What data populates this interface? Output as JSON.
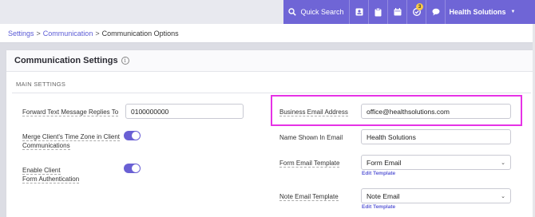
{
  "topbar": {
    "search_label": "Quick Search",
    "badge_count": "3",
    "org_name": "Health Solutions",
    "icons": [
      "search-icon",
      "contacts-icon",
      "clipboard-icon",
      "calendar-icon",
      "tasks-icon",
      "chat-icon"
    ]
  },
  "breadcrumb": {
    "items": [
      "Settings",
      "Communication",
      "Communication Options"
    ],
    "separator": ">"
  },
  "card": {
    "title": "Communication Settings",
    "info_glyph": "i",
    "section": "MAIN SETTINGS"
  },
  "left": {
    "forward_label": "Forward Text Message Replies To",
    "forward_value": "0100000000",
    "merge_label_1": "Merge Client's Time Zone in Client",
    "merge_label_2": "Communications",
    "merge_on": true,
    "enable_label_1": "Enable Client",
    "enable_label_2": "Form Authentication",
    "enable_on": true
  },
  "right": {
    "business_email_label": "Business Email Address",
    "business_email_value": "office@healthsolutions.com",
    "name_label": "Name Shown In Email",
    "name_value": "Health Solutions",
    "form_template_label": "Form Email Template",
    "form_template_value": "Form Email",
    "edit_template_1": "Edit Template",
    "note_template_label": "Note Email Template",
    "note_template_value": "Note Email",
    "edit_template_2": "Edit Template"
  },
  "colors": {
    "accent": "#6f65d6",
    "highlight": "#e632e6",
    "link": "#5b5bd6"
  }
}
